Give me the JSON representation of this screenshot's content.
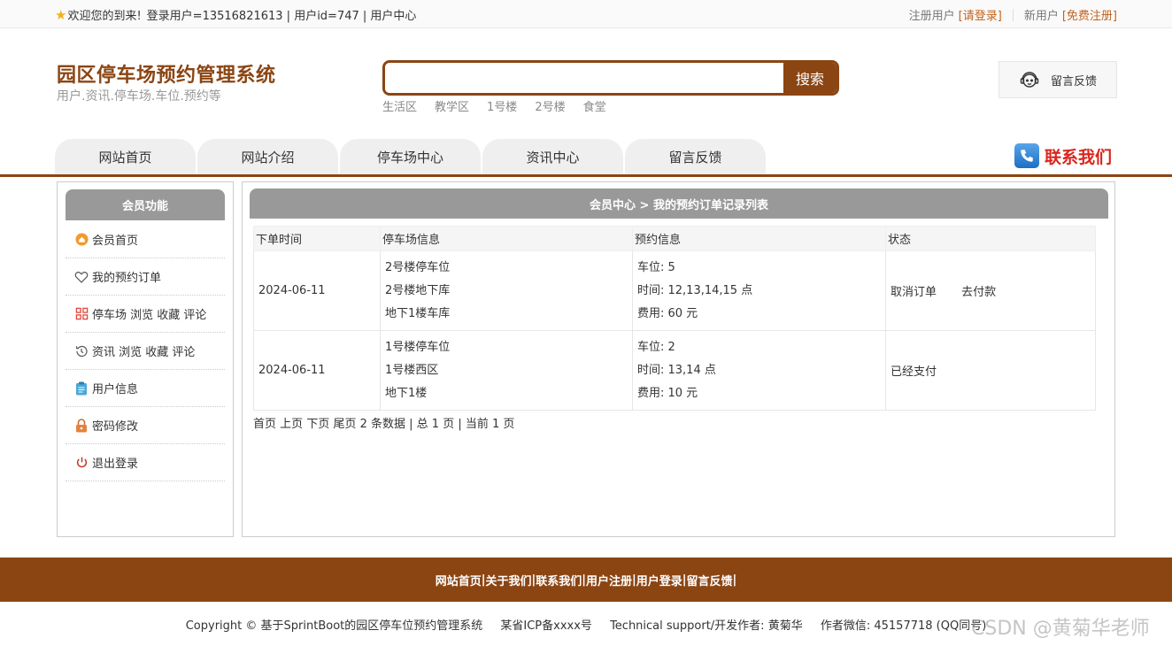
{
  "topbar": {
    "welcome": "欢迎您的到来!",
    "user_info": "登录用户=13516821613 | 用户id=747 | 用户中心",
    "register_user": "注册用户",
    "login_link": "[请登录]",
    "new_user": "新用户",
    "free_register": "[免费注册]"
  },
  "header": {
    "title": "园区停车场预约管理系统",
    "subtitle": "用户.资讯.停车场.车位.预约等",
    "search_button": "搜索",
    "search_value": "",
    "hot_keywords": [
      "生活区",
      "教学区",
      "1号楼",
      "2号楼",
      "食堂"
    ],
    "feedback": "留言反馈",
    "contact": "联系我们"
  },
  "nav": [
    "网站首页",
    "网站介绍",
    "停车场中心",
    "资讯中心",
    "留言反馈"
  ],
  "sidebar": {
    "title": "会员功能",
    "items": [
      {
        "label": "会员首页",
        "icon": "home-icon"
      },
      {
        "label": "我的预约订单",
        "icon": "heart-icon"
      },
      {
        "label": "停车场 浏览 收藏 评论",
        "icon": "grid-icon"
      },
      {
        "label": "资讯 浏览 收藏 评论",
        "icon": "history-icon"
      },
      {
        "label": "用户信息",
        "icon": "clipboard-icon"
      },
      {
        "label": "密码修改",
        "icon": "lock-icon"
      },
      {
        "label": "退出登录",
        "icon": "power-icon"
      }
    ]
  },
  "main": {
    "breadcrumb": "会员中心 > 我的预约订单记录列表",
    "columns": [
      "下单时间",
      "停车场信息",
      "预约信息",
      "状态"
    ],
    "rows": [
      {
        "time": "2024-06-11",
        "lot": [
          "2号楼停车位",
          "2号楼地下库",
          "地下1楼车库"
        ],
        "booking": [
          "车位: 5",
          "时间: 12,13,14,15 点",
          "费用: 60 元"
        ],
        "actions": [
          "取消订单",
          "去付款"
        ]
      },
      {
        "time": "2024-06-11",
        "lot": [
          "1号楼停车位",
          "1号楼西区",
          "地下1楼"
        ],
        "booking": [
          "车位: 2",
          "时间: 13,14 点",
          "费用: 10 元"
        ],
        "actions": [
          "已经支付"
        ]
      }
    ],
    "pager": {
      "first": "首页",
      "prev": "上页",
      "next": "下页",
      "last": "尾页",
      "summary": "2 条数据 | 总 1 页 | 当前 1 页"
    }
  },
  "footer": {
    "links": [
      "网站首页",
      "关于我们",
      "联系我们",
      "用户注册",
      "用户登录",
      "留言反馈"
    ],
    "copyright": "Copyright © 基于SprintBoot的园区停车位预约管理系统",
    "icp": "某省ICP备xxxx号",
    "support": "Technical support/开发作者: 黄菊华",
    "wechat": "作者微信: 45157718 (QQ同号)",
    "watermark": "CSDN @黄菊华老师"
  },
  "colors": {
    "brand": "#8b4513",
    "accent_link": "#c2621c",
    "contact_red": "#d9261c",
    "panel_header": "#999999"
  }
}
